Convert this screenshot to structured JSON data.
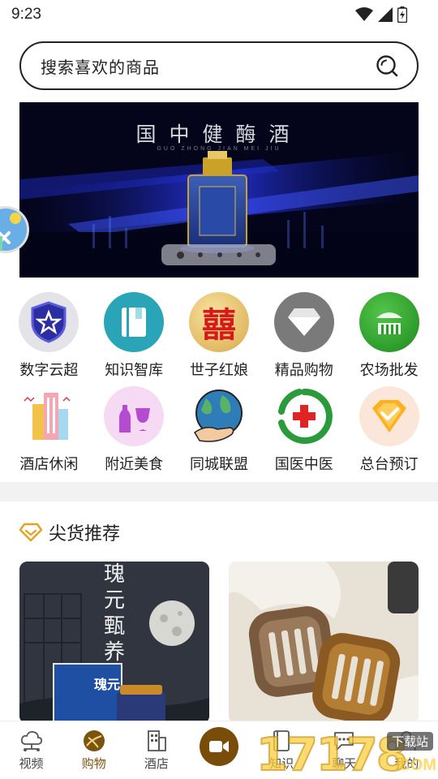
{
  "status_bar": {
    "time": "9:23"
  },
  "search": {
    "placeholder": "搜索喜欢的商品"
  },
  "banner": {
    "title": "国中健酶酒",
    "subtitle": "GUO ZHONG JIAN MEI JIU",
    "dot_count": 5,
    "active_dot": 0
  },
  "categories": [
    [
      {
        "label": "数字云超",
        "icon": "shield-star-icon"
      },
      {
        "label": "知识智库",
        "icon": "book-icon"
      },
      {
        "label": "世子红娘",
        "icon": "double-happiness-icon"
      },
      {
        "label": "精品购物",
        "icon": "diamond-icon"
      },
      {
        "label": "农场批发",
        "icon": "farm-icon"
      }
    ],
    [
      {
        "label": "酒店休闲",
        "icon": "building-icon"
      },
      {
        "label": "附近美食",
        "icon": "wine-glass-icon"
      },
      {
        "label": "同城联盟",
        "icon": "globe-hand-icon"
      },
      {
        "label": "国医中医",
        "icon": "medical-cross-icon"
      },
      {
        "label": "总台预订",
        "icon": "badge-check-icon"
      }
    ]
  ],
  "recommend": {
    "title": "尖货推荐",
    "products": [
      {
        "image_text": "瑰元甄养",
        "label": "瑰元",
        "icon": "product-liquor-icon"
      },
      {
        "icon": "product-hair-clip-icon"
      }
    ]
  },
  "bottom_nav": [
    {
      "label": "视频",
      "icon": "cloud-network-icon",
      "active": false
    },
    {
      "label": "购物",
      "icon": "shopping-bag-icon",
      "active": true
    },
    {
      "label": "酒店",
      "icon": "hotel-building-icon",
      "active": false
    },
    {
      "label": "",
      "icon": "video-camera-icon",
      "active": false
    },
    {
      "label": "知识",
      "icon": "book-open-icon",
      "active": false
    },
    {
      "label": "聊天",
      "icon": "chat-bubble-icon",
      "active": false
    },
    {
      "label": "我的",
      "icon": "person-icon",
      "active": false
    }
  ],
  "watermark": {
    "text": "17178",
    "tag": "下载站",
    "suffix": "COM"
  },
  "colors": {
    "accent": "#e8a020",
    "nav_active": "#7a5510",
    "nav_center_bg": "#7a4c0a",
    "banner_bg": "#04051a"
  }
}
